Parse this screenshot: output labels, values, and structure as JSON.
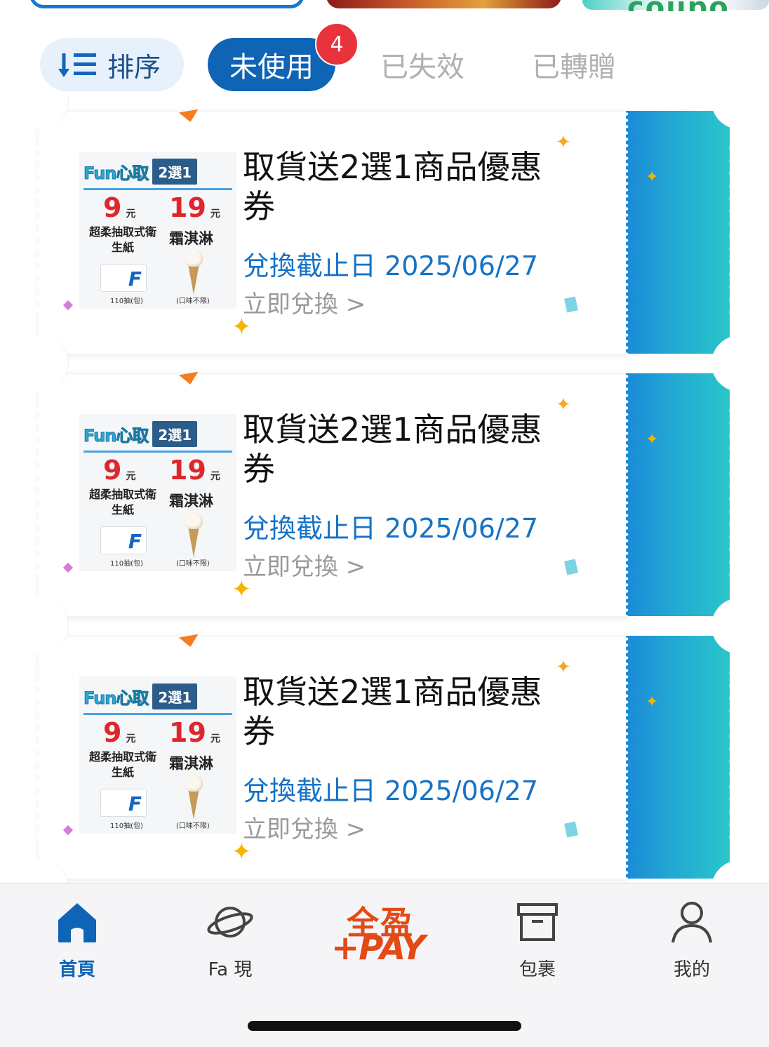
{
  "top_strip": {
    "partial_text": "coupo"
  },
  "tabs": {
    "sort_label": "排序",
    "unused_label": "未使用",
    "unused_badge": "4",
    "expired_label": "已失效",
    "transferred_label": "已轉贈"
  },
  "coupons": [
    {
      "title": "取貨送2選1商品優惠券",
      "expiry_label": "兌換截止日",
      "expiry_date": "2025/06/27",
      "action": "立即兌換 >",
      "image": {
        "logo": "Fun心取",
        "tag": "2選1",
        "price1": "9",
        "price2": "19",
        "unit": "元",
        "item1": "超柔抽取式衛生紙",
        "item2": "霜淇淋",
        "sub1": "110抽(包)",
        "sub2": "(口味不限)",
        "box_letter": "F"
      }
    },
    {
      "title": "取貨送2選1商品優惠券",
      "expiry_label": "兌換截止日",
      "expiry_date": "2025/06/27",
      "action": "立即兌換 >",
      "image": {
        "logo": "Fun心取",
        "tag": "2選1",
        "price1": "9",
        "price2": "19",
        "unit": "元",
        "item1": "超柔抽取式衛生紙",
        "item2": "霜淇淋",
        "sub1": "110抽(包)",
        "sub2": "(口味不限)",
        "box_letter": "F"
      }
    },
    {
      "title": "取貨送2選1商品優惠券",
      "expiry_label": "兌換截止日",
      "expiry_date": "2025/06/27",
      "action": "立即兌換 >",
      "image": {
        "logo": "Fun心取",
        "tag": "2選1",
        "price1": "9",
        "price2": "19",
        "unit": "元",
        "item1": "超柔抽取式衛生紙",
        "item2": "霜淇淋",
        "sub1": "110抽(包)",
        "sub2": "(口味不限)",
        "box_letter": "F"
      }
    }
  ],
  "bottom_nav": {
    "items": [
      {
        "label": "首頁",
        "icon": "home-icon",
        "active": true
      },
      {
        "label": "Fa 現",
        "icon": "planet-icon",
        "active": false
      },
      {
        "label": "包裹",
        "icon": "package-icon",
        "active": false
      },
      {
        "label": "我的",
        "icon": "profile-icon",
        "active": false
      }
    ],
    "pay_line1": "全盈",
    "pay_line2": "+PAY"
  },
  "colors": {
    "primary": "#0f64b6",
    "badge": "#e8323c",
    "stub_start": "#1b8ad6",
    "stub_end": "#2ac6c9",
    "pay_brand": "#e24a16",
    "expiry_text": "#1672c6"
  }
}
